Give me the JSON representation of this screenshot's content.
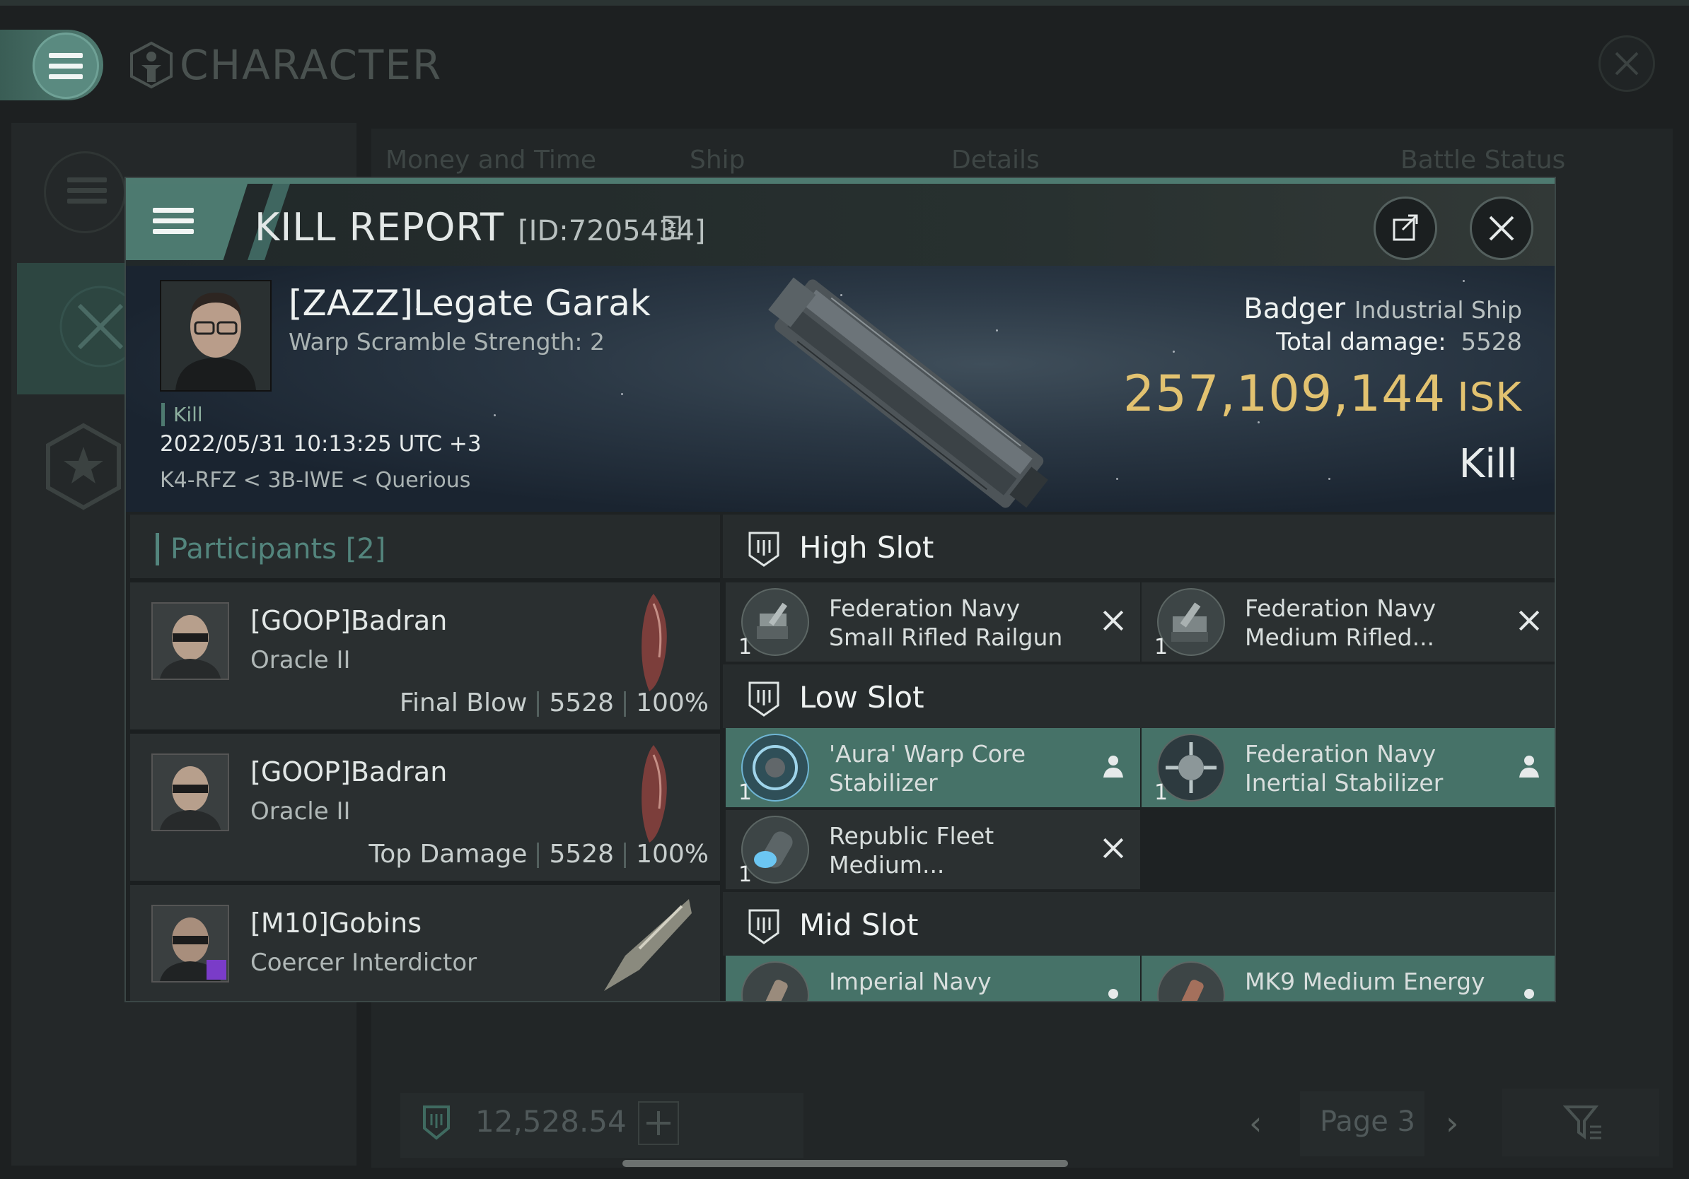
{
  "background": {
    "title": "CHARACTER",
    "tabs": [
      "Money and Time",
      "Ship",
      "Details",
      "Battle Status"
    ],
    "wallet_value": "12,528.54",
    "page_label": "Page 3"
  },
  "kill_report": {
    "title": "KILL REPORT",
    "id_label": "[ID:7205434]",
    "victim": {
      "name": "[ZAZZ]Legate Garak",
      "warp_scramble": "Warp Scramble Strength: 2",
      "tag": "Kill",
      "timestamp": "2022/05/31 10:13:25 UTC +3",
      "location": "K4-RFZ < 3B-IWE < Querious"
    },
    "ship": {
      "name": "Badger",
      "class": "Industrial Ship",
      "total_damage_label": "Total damage:",
      "total_damage": "5528",
      "isk_value": "257,109,144",
      "isk_unit": "ISK",
      "result": "Kill"
    },
    "participants": {
      "title": "Participants",
      "count": "[2]",
      "list": [
        {
          "name": "[GOOP]Badran",
          "ship": "Oracle II",
          "role": "Final Blow",
          "damage": "5528",
          "percent": "100%"
        },
        {
          "name": "[GOOP]Badran",
          "ship": "Oracle II",
          "role": "Top Damage",
          "damage": "5528",
          "percent": "100%"
        },
        {
          "name": "[M10]Gobins",
          "ship": "Coercer Interdictor",
          "role": "",
          "damage": "",
          "percent": ""
        }
      ]
    },
    "slots": {
      "high": {
        "title": "High Slot",
        "items": [
          {
            "qty": "1",
            "name": "Federation Navy Small Rifled Railgun",
            "status": "destroyed"
          },
          {
            "qty": "1",
            "name": "Federation Navy Medium Rifled...",
            "status": "destroyed"
          }
        ]
      },
      "low": {
        "title": "Low Slot",
        "items": [
          {
            "qty": "1",
            "name": "'Aura' Warp Core Stabilizer",
            "status": "dropped"
          },
          {
            "qty": "1",
            "name": "Federation Navy Inertial Stabilizer",
            "status": "dropped"
          },
          {
            "qty": "1",
            "name": "Republic Fleet Medium...",
            "status": "destroyed"
          }
        ]
      },
      "mid": {
        "title": "Mid Slot",
        "items": [
          {
            "qty": "",
            "name": "Imperial Navy",
            "status": "dropped"
          },
          {
            "qty": "",
            "name": "MK9 Medium Energy",
            "status": "dropped"
          }
        ]
      }
    }
  },
  "colors": {
    "accent": "#4e7a70",
    "dropped": "#467268",
    "isk": "#e2c270",
    "participants_title": "#53857d"
  },
  "icons": [
    "menu-icon",
    "character-icon",
    "close-icon",
    "copy-icon",
    "share-icon",
    "slot-icon",
    "person-icon",
    "x-icon",
    "star-icon",
    "swords-icon",
    "filter-icon",
    "plus-icon"
  ]
}
